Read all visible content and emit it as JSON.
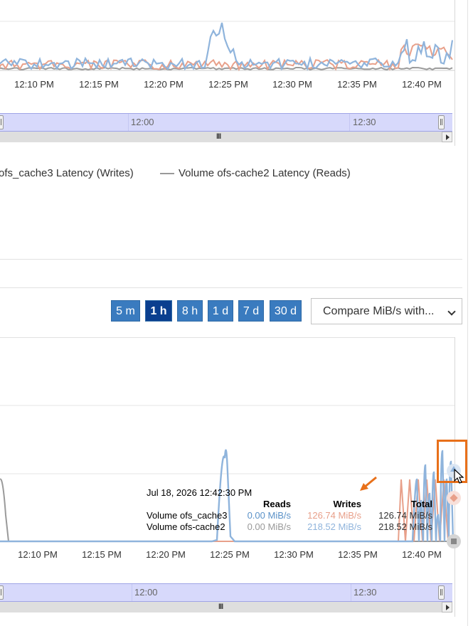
{
  "top_chart": {
    "x_ticks": [
      "12:10 PM",
      "12:15 PM",
      "12:20 PM",
      "12:25 PM",
      "12:30 PM",
      "12:35 PM",
      "12:40 PM"
    ],
    "navigator_labels": [
      "12:00",
      "12:30"
    ],
    "legend": [
      {
        "label": "ofs_cache3 Latency (Writes)",
        "color": "#999999"
      },
      {
        "label": "Volume ofs-cache2 Latency (Reads)",
        "color": "#999999"
      }
    ]
  },
  "controls": {
    "range_buttons": [
      {
        "label": "5 m",
        "active": false
      },
      {
        "label": "1 h",
        "active": true
      },
      {
        "label": "8 h",
        "active": false
      },
      {
        "label": "1 d",
        "active": false
      },
      {
        "label": "7 d",
        "active": false
      },
      {
        "label": "30 d",
        "active": false
      }
    ],
    "compare_select": "Compare MiB/s with..."
  },
  "bottom_chart": {
    "x_ticks": [
      "12:10 PM",
      "12:15 PM",
      "12:20 PM",
      "12:25 PM",
      "12:30 PM",
      "12:35 PM",
      "12:40 PM"
    ],
    "navigator_labels": [
      "12:00",
      "12:30"
    ],
    "tooltip": {
      "timestamp": "Jul 18, 2026 12:42:30 PM",
      "headers": {
        "reads": "Reads",
        "writes": "Writes",
        "total": "Total"
      },
      "rows": [
        {
          "name": "Volume ofs_cache3",
          "reads": "0.00 MiB/s",
          "writes": "126.74 MiB/s",
          "total": "126.74 MiB/s"
        },
        {
          "name": "Volume ofs-cache2",
          "reads": "0.00 MiB/s",
          "writes": "218.52 MiB/s",
          "total": "218.52 MiB/s"
        }
      ]
    }
  },
  "colors": {
    "reads_series": "#8fb4dc",
    "writes_series": "#e8a08a",
    "gray_series": "#9a9a9a",
    "accent_button": "#3a7bbf",
    "active_button": "#0b3f8f",
    "highlight": "#e8701a"
  }
}
